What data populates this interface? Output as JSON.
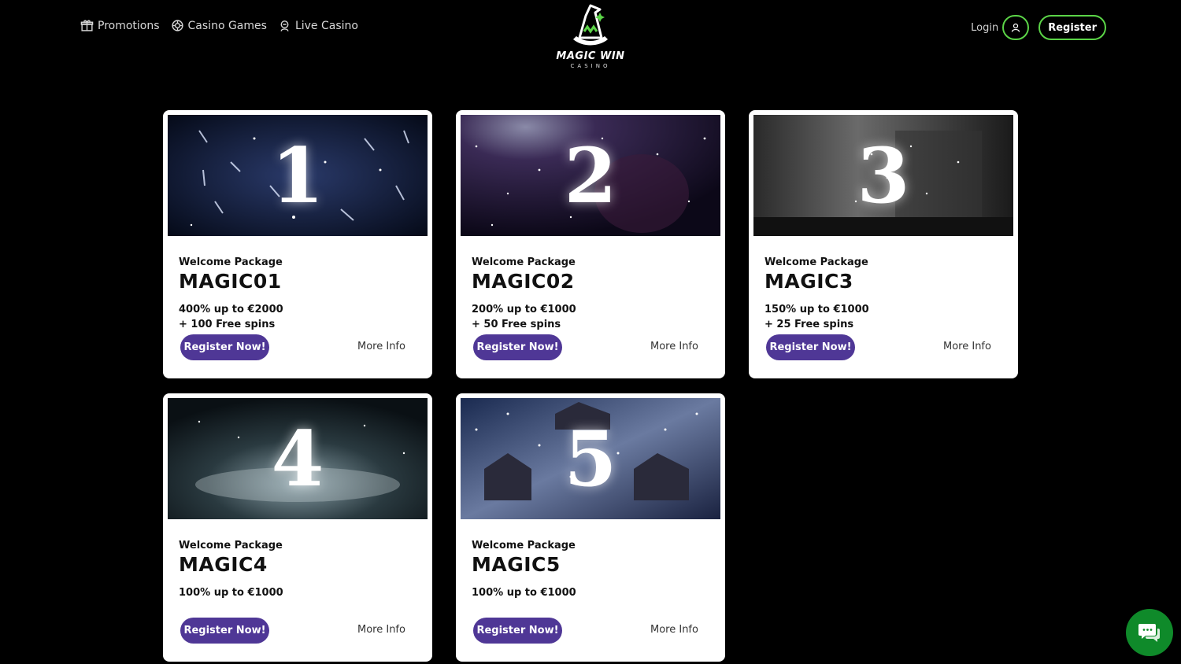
{
  "nav": {
    "items": [
      {
        "label": "Promotions",
        "icon": "gift-icon"
      },
      {
        "label": "Casino Games",
        "icon": "chip-icon"
      },
      {
        "label": "Live Casino",
        "icon": "dealer-icon"
      }
    ]
  },
  "logo": {
    "text": "MAGIC WIN",
    "subtext": "CASINO"
  },
  "auth": {
    "login_label": "Login",
    "register_label": "Register"
  },
  "colors": {
    "accent_green": "#5bd447",
    "button_purple": "#4f3796",
    "chat_green": "#0f8a2a"
  },
  "cards": [
    {
      "number": "1",
      "package": "Welcome Package",
      "code": "MAGIC01",
      "offer_line1": "400% up to €2000",
      "offer_line2": "+ 100 Free spins",
      "cta": "Register Now!",
      "more": "More Info"
    },
    {
      "number": "2",
      "package": "Welcome Package",
      "code": "MAGIC02",
      "offer_line1": "200% up to €1000",
      "offer_line2": "+ 50 Free spins",
      "cta": "Register Now!",
      "more": "More Info"
    },
    {
      "number": "3",
      "package": "Welcome Package",
      "code": "MAGIC3",
      "offer_line1": "150% up to €1000",
      "offer_line2": "+ 25 Free spins",
      "cta": "Register Now!",
      "more": "More Info"
    },
    {
      "number": "4",
      "package": "Welcome Package",
      "code": "MAGIC4",
      "offer_line1": "100% up to €1000",
      "offer_line2": "",
      "cta": "Register Now!",
      "more": "More Info"
    },
    {
      "number": "5",
      "package": "Welcome Package",
      "code": "MAGIC5",
      "offer_line1": "100% up to €1000",
      "offer_line2": "",
      "cta": "Register Now!",
      "more": "More Info"
    }
  ],
  "chat": {
    "icon": "chat-icon"
  }
}
